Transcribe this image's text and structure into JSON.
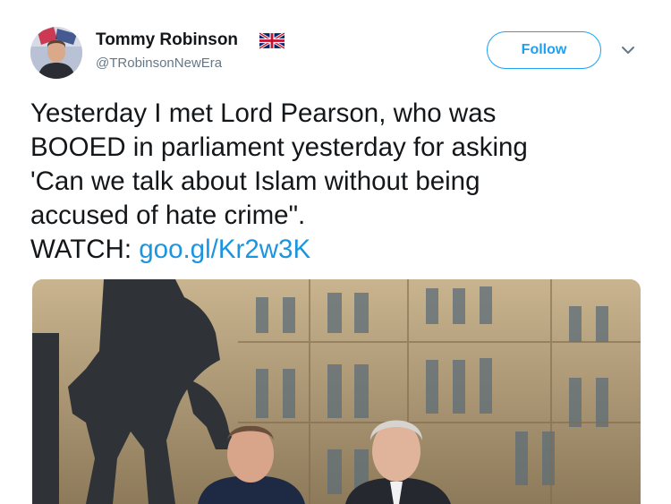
{
  "tweet": {
    "author_name": "Tommy Robinson",
    "handle": "@TRobinsonNewEra",
    "follow_label": "Follow",
    "text_body": "Yesterday I met Lord Pearson, who was\nBOOED in parliament yesterday for asking\n'Can we talk about Islam without being\naccused of hate crime\".\nWATCH: ",
    "link_text": "goo.gl/Kr2w3K"
  },
  "icons": {
    "flag": "uk-flag-icon",
    "menu": "chevron-down-icon"
  },
  "colors": {
    "accent": "#1da1f2",
    "link": "#1b95e0",
    "secondary_text": "#657786",
    "text": "#14171a"
  }
}
